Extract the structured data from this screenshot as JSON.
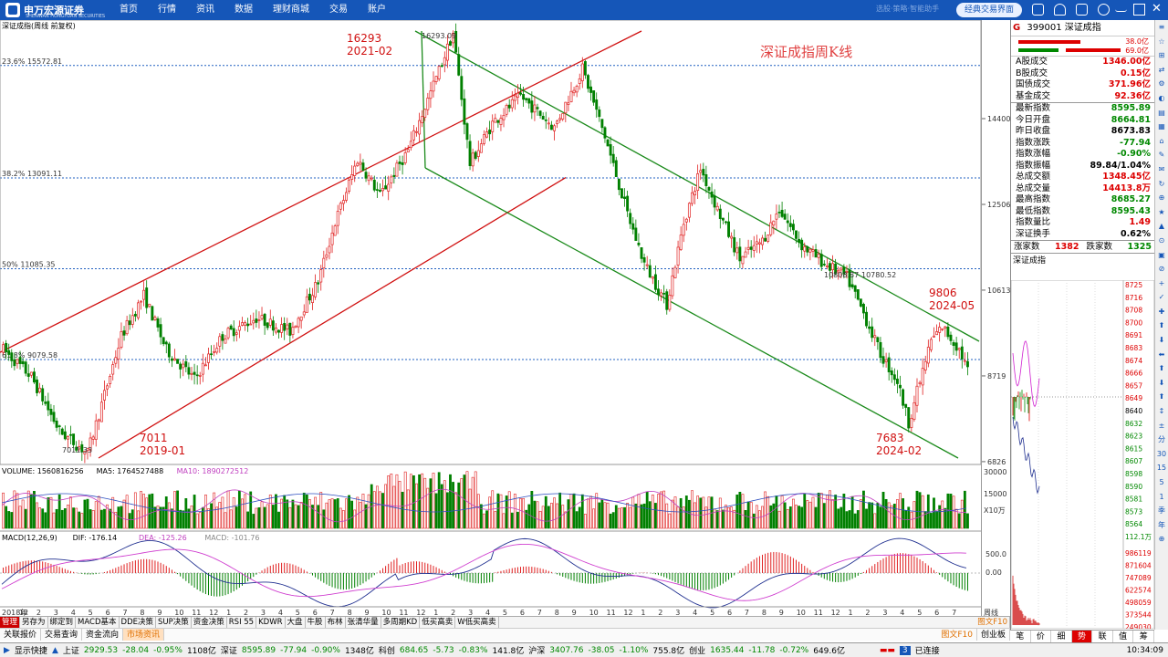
{
  "topbar": {
    "logo": "申万宏源证券",
    "logo_sub": "SHENWAN HONGYUAN SECURITIES",
    "nav": [
      "首页",
      "行情",
      "资讯",
      "数据",
      "理财商城",
      "交易",
      "账户"
    ],
    "faint_link": "选股·策略·智能助手",
    "classic_button": "经典交易界面",
    "icons": [
      "document-icon",
      "headset-icon",
      "mail-icon",
      "settings-icon",
      "minimize-icon",
      "restore-icon",
      "close-icon"
    ]
  },
  "chart": {
    "title": "深证成指(周线 前复权)",
    "big_label": "深证成指周K线",
    "fib": [
      {
        "label": "23.6% 15572.81",
        "price": 15573
      },
      {
        "label": "38.2% 13091.11",
        "price": 13091
      },
      {
        "label": "50% 11085.35",
        "price": 11085
      },
      {
        "label": "61.8% 9079.58",
        "price": 9080
      }
    ],
    "annotations": [
      {
        "text1": "16293",
        "text2": "2021-02"
      },
      {
        "text1": "7011",
        "text2": "2019-01"
      },
      {
        "text1": "7683",
        "text2": "2024-02"
      },
      {
        "text1": "9806",
        "text2": "2024-05"
      }
    ],
    "price_labels": {
      "high": "16293.09",
      "low": "7011.33",
      "mid1": "10808.87",
      "mid2": "10780.52"
    },
    "y_ticks": [
      14400,
      12506,
      10613,
      8719,
      6826
    ],
    "vol_title": {
      "name": "VOLUME: 1560816256",
      "ma5": "MA5: 1764527488",
      "ma10": "MA10: 1890272512"
    },
    "vol_ticks": [
      "30000",
      "15000",
      "X10万"
    ],
    "macd_title": {
      "name": "MACD(12,26,9)",
      "dif": "DIF: -176.14",
      "dea": "DEA: -125.26",
      "macd": "MACD: -101.76"
    },
    "macd_ticks": [
      "500.0",
      "0.00"
    ],
    "x_labels": [
      "2018年",
      "12",
      "2",
      "3",
      "4",
      "5",
      "6",
      "7",
      "8",
      "9",
      "10",
      "11",
      "12",
      "1",
      "2",
      "3",
      "4",
      "5",
      "6",
      "7",
      "8",
      "9",
      "10",
      "11",
      "12",
      "1",
      "2",
      "3",
      "4",
      "5",
      "6",
      "7",
      "8",
      "9",
      "10",
      "11",
      "12",
      "1",
      "2",
      "3",
      "4",
      "5",
      "6",
      "7",
      "8",
      "9",
      "10",
      "11",
      "12",
      "1",
      "2",
      "3",
      "4",
      "5",
      "6",
      "7"
    ],
    "x_end_label": "周线",
    "colors": {
      "up": "#e02020",
      "down": "#008000",
      "channel_up": "#d01010",
      "channel_down": "#1a8a1a",
      "fib": "#2060c0"
    }
  },
  "chart_data": {
    "type": "candlestick",
    "title": "深证成指(周线 前复权)",
    "key_points": [
      {
        "label": "2019-01 low",
        "value": 7011.33
      },
      {
        "label": "2021-02 high",
        "value": 16293.09
      },
      {
        "label": "2024-02 low",
        "value": 7683
      },
      {
        "label": "2024-05 high",
        "value": 9806
      }
    ],
    "ylim": [
      6826,
      16600
    ]
  },
  "panel": {
    "code": "399001",
    "name": "深证成指",
    "g": "G",
    "bar_vals": [
      "38.0亿",
      "69.0亿"
    ],
    "rows1": [
      {
        "k": "A股成交",
        "v": "1346.00亿",
        "c": "red"
      },
      {
        "k": "B股成交",
        "v": "0.15亿",
        "c": "red"
      },
      {
        "k": "国债成交",
        "v": "371.96亿",
        "c": "red"
      },
      {
        "k": "基金成交",
        "v": "92.36亿",
        "c": "red"
      }
    ],
    "rows2": [
      {
        "k": "最新指数",
        "v": "8595.89",
        "c": "green"
      },
      {
        "k": "今日开盘",
        "v": "8664.81",
        "c": "green"
      },
      {
        "k": "昨日收盘",
        "v": "8673.83",
        "c": "blk"
      },
      {
        "k": "指数涨跌",
        "v": "-77.94",
        "c": "green"
      },
      {
        "k": "指数涨幅",
        "v": "-0.90%",
        "c": "green"
      },
      {
        "k": "指数振幅",
        "v": "89.84/1.04%",
        "c": "blk"
      },
      {
        "k": "总成交额",
        "v": "1348.45亿",
        "c": "red"
      },
      {
        "k": "总成交量",
        "v": "14413.8万",
        "c": "red"
      },
      {
        "k": "最高指数",
        "v": "8685.27",
        "c": "green"
      },
      {
        "k": "最低指数",
        "v": "8595.43",
        "c": "green"
      },
      {
        "k": "指数量比",
        "v": "1.49",
        "c": "red"
      },
      {
        "k": "深证换手",
        "v": "0.62%",
        "c": "blk"
      }
    ],
    "up_label": "涨家数",
    "up_val": "1382",
    "down_label": "跌家数",
    "down_val": "1325",
    "mini_title": "深证成指",
    "mini_ticks": [
      "8725",
      "8716",
      "8708",
      "8700",
      "8691",
      "8683",
      "8674",
      "8666",
      "8657",
      "8649",
      "8640",
      "8632",
      "8623",
      "8615",
      "8607",
      "8598",
      "8590",
      "8581",
      "8573",
      "8564",
      "112.1万"
    ],
    "mini_vol_ticks": [
      "986119",
      "871604",
      "747089",
      "622574",
      "498059",
      "373544",
      "249030",
      "124515"
    ],
    "tabs": [
      "笔",
      "价",
      "细",
      "势",
      "联",
      "值",
      "筹"
    ]
  },
  "far_toolbar": [
    "≡",
    "☆",
    "⊞",
    "⇄",
    "⚙",
    "◐",
    "▤",
    "▦",
    "⌂",
    "✎",
    "✉",
    "↻",
    "⊕",
    "★",
    "▲",
    "⊙",
    "▣",
    "⊘",
    "+",
    "✓",
    "✚",
    "⬆",
    "⬇",
    "⬅",
    "⬆",
    "⬇",
    "⬆",
    "↕",
    "±",
    "分",
    "30",
    "15",
    "5",
    "1",
    "季",
    "年",
    "⊕"
  ],
  "bottom_tabs": [
    "管理",
    "另存为",
    "绑定到",
    "MACD基本",
    "DDE决策",
    "SUP决策",
    "资金决策",
    "RSI 55",
    "KDWR",
    "大盘",
    "牛股",
    "布林",
    "张清华量",
    "多周期KD",
    "低买高卖",
    "W低买高卖"
  ],
  "bottom_right": "图文F10",
  "sub_tabs": [
    "关联报价",
    "交易查询",
    "资金流向",
    "市场资讯"
  ],
  "sub_right": [
    "图文F10",
    "创业板"
  ],
  "status": {
    "label": "显示快捷",
    "sh_name": "上证",
    "sh_val": "2929.53",
    "sh_chg": "-28.04",
    "sh_pct": "-0.95%",
    "sh_amt": "1108亿",
    "sz_name": "深证",
    "sz_val": "8595.89",
    "sz_chg": "-77.94",
    "sz_pct": "-0.90%",
    "sz_amt": "1348亿",
    "kc_name": "科创",
    "kc_val": "684.65",
    "kc_chg": "-5.73",
    "kc_pct": "-0.83%",
    "kc_amt": "141.8亿",
    "hs_name": "沪深",
    "hs_val": "3407.76",
    "hs_chg": "-38.05",
    "hs_pct": "-1.10%",
    "hs_amt": "755.8亿",
    "cy_name": "创业",
    "cy_val": "1635.44",
    "cy_chg": "-11.78",
    "cy_pct": "-0.72%",
    "cy_amt": "649.6亿",
    "conn": "已连接",
    "time": "10:34:09"
  }
}
